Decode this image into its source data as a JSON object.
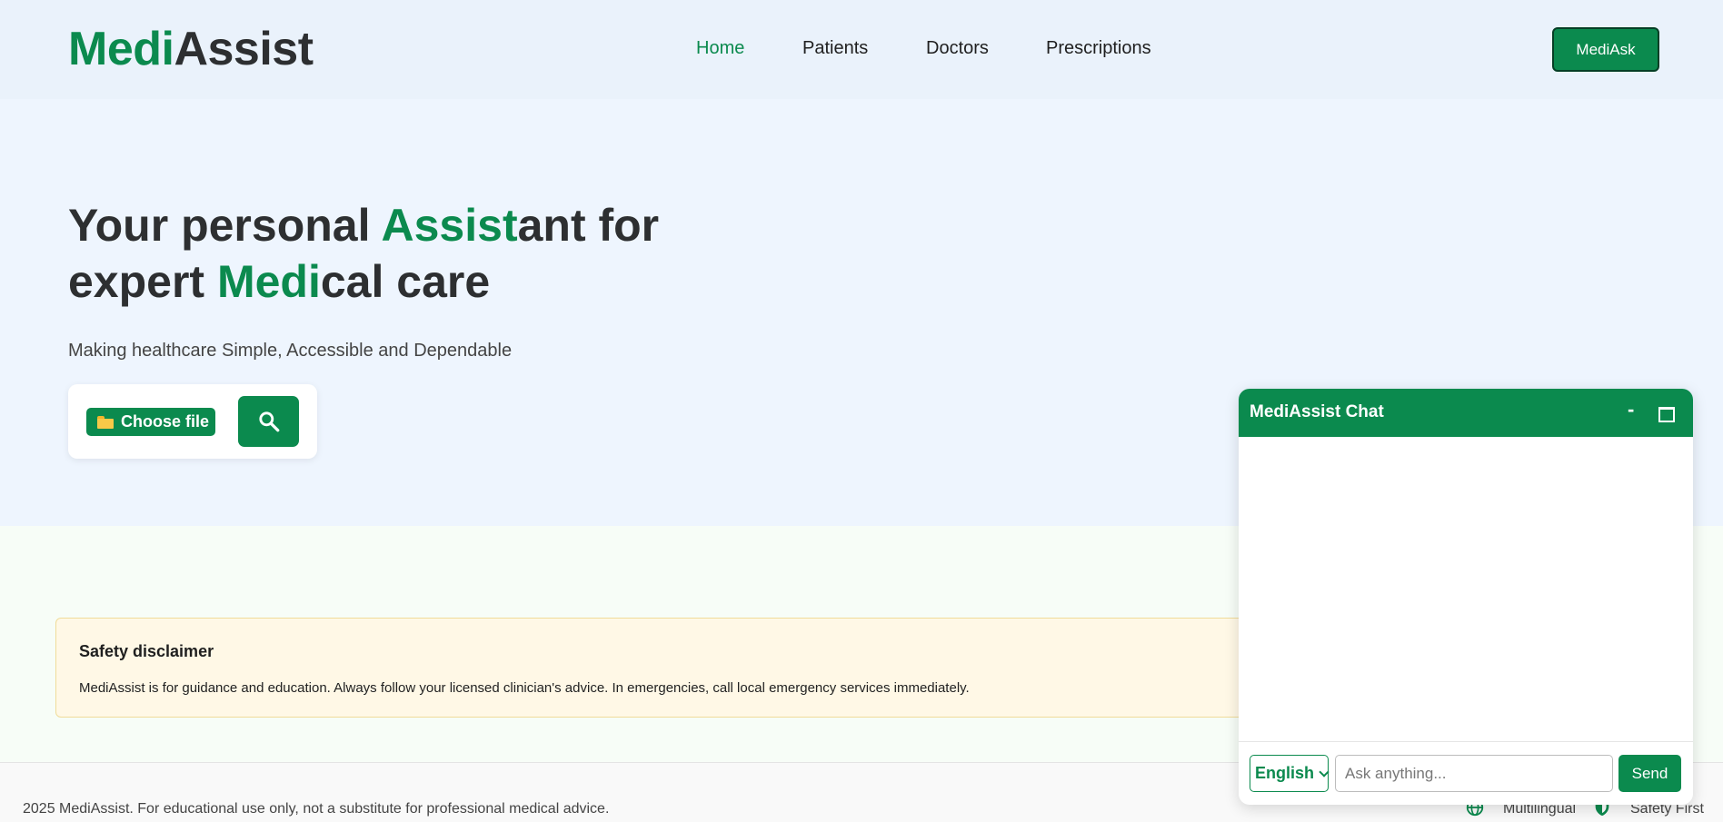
{
  "header": {
    "logo_part1": "Medi",
    "logo_part2": "Assist",
    "nav": [
      {
        "label": "Home",
        "active": true
      },
      {
        "label": "Patients",
        "active": false
      },
      {
        "label": "Doctors",
        "active": false
      },
      {
        "label": "Prescriptions",
        "active": false
      }
    ],
    "cta_label": "MediAsk"
  },
  "hero": {
    "line1_a": "Your personal ",
    "line1_b": "Assist",
    "line1_c": "ant for",
    "line2_a": "expert ",
    "line2_b": "Medi",
    "line2_c": "cal care",
    "subtitle": "Making healthcare Simple, Accessible and Dependable",
    "choose_file_label": "Choose file"
  },
  "disclaimer": {
    "title": "Safety disclaimer",
    "text": "MediAssist is for guidance and education. Always follow your licensed clinician's advice. In emergencies, call local emergency services immediately."
  },
  "footer": {
    "copyright": "2025 MediAssist. For educational use only, not a substitute for professional medical advice.",
    "badges": [
      {
        "label": "Multilingual",
        "icon": "globe-icon"
      },
      {
        "label": "Safety First",
        "icon": "shield-icon"
      }
    ]
  },
  "chat": {
    "title": "MediAssist Chat",
    "minimize_label": "-",
    "language": "English",
    "placeholder": "Ask anything...",
    "send_label": "Send"
  },
  "colors": {
    "brand_green": "#0b8a4e",
    "dark_text": "#2d2f31",
    "hero_bg": "#eef5fe",
    "disclaimer_bg": "#fff8e6"
  }
}
